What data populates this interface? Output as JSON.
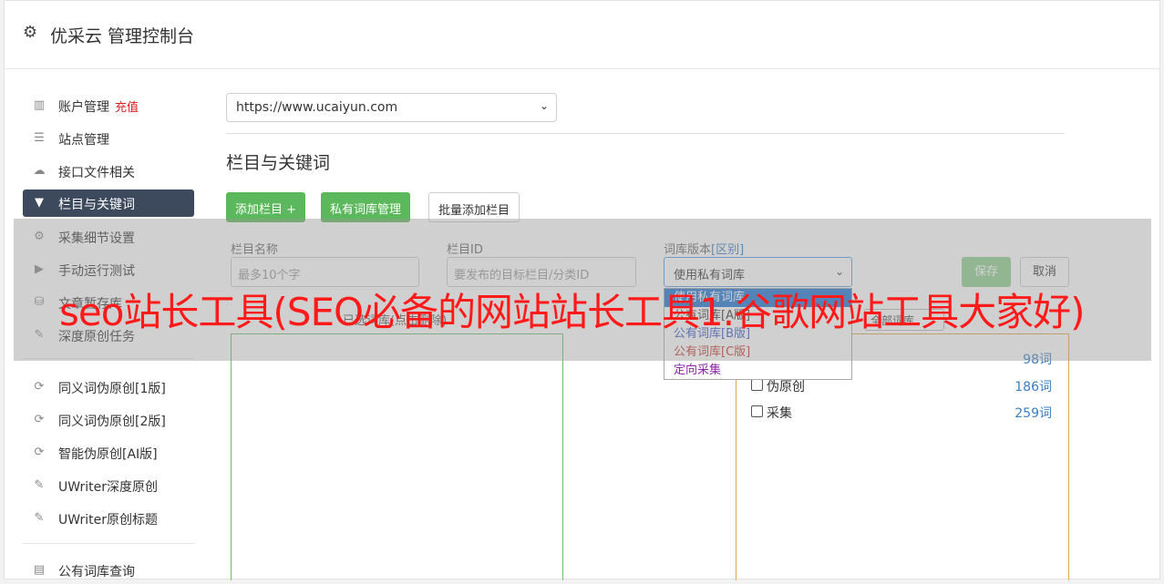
{
  "header": {
    "title": "优采云 管理控制台"
  },
  "sidebar": {
    "items": [
      {
        "label": "账户管理",
        "extra": "充值",
        "icon": "bar-chart-icon"
      },
      {
        "label": "站点管理",
        "icon": "server-icon"
      },
      {
        "label": "接口文件相关",
        "icon": "cloud-upload-icon"
      },
      {
        "label": "栏目与关键词",
        "icon": "filter-icon",
        "active": true
      },
      {
        "label": "采集细节设置",
        "icon": "cogs-icon"
      },
      {
        "label": "手动运行测试",
        "icon": "play-icon"
      },
      {
        "label": "文章暂存库",
        "icon": "database-icon"
      },
      {
        "label": "深度原创任务",
        "icon": "edit-icon"
      },
      {
        "label": "同义词伪原创[1版]",
        "icon": "refresh-icon"
      },
      {
        "label": "同义词伪原创[2版]",
        "icon": "refresh-icon"
      },
      {
        "label": "智能伪原创[AI版]",
        "icon": "refresh-icon"
      },
      {
        "label": "UWriter深度原创",
        "icon": "edit-icon"
      },
      {
        "label": "UWriter原创标题",
        "icon": "edit-icon"
      },
      {
        "label": "公有词库查询",
        "icon": "book-icon"
      }
    ]
  },
  "site_select": {
    "value": "https://www.ucaiyun.com"
  },
  "section": {
    "title": "栏目与关键词"
  },
  "buttons": {
    "add_column": "添加栏目 +",
    "private_lib": "私有词库管理",
    "batch_add": "批量添加栏目",
    "save": "保存",
    "cancel": "取消"
  },
  "form": {
    "name_label": "栏目名称",
    "name_placeholder": "最多10个字",
    "id_label": "栏目ID",
    "id_placeholder": "要发布的目标栏目/分类ID",
    "version_label": "词库版本",
    "version_link": "[区别]",
    "version_value": "使用私有词库",
    "version_options": [
      "使用私有词库",
      "公有词库[A版]",
      "公有词库[B版]",
      "公有词库[C版]",
      "定向采集"
    ]
  },
  "selector": {
    "hint": "已选词库(点击删除)",
    "mini_select": "全部词库"
  },
  "libraries": [
    {
      "name": "",
      "count": "98词"
    },
    {
      "name": "伪原创",
      "count": "186词"
    },
    {
      "name": "采集",
      "count": "259词"
    }
  ],
  "watermark": "seo站长工具(SEO必备的网站站长工具1.谷歌网站工具大家好)",
  "colors": {
    "active_bg": "#3d4a5e",
    "green": "#5cb85c",
    "accent_red": "#ff1a1a",
    "link_blue": "#3a7fc1"
  }
}
